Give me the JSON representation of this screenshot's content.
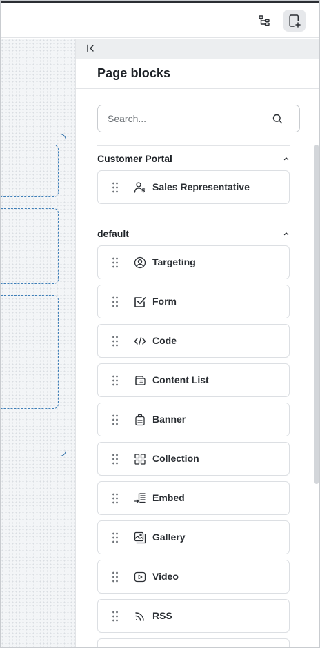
{
  "toolbar": {
    "tree_icon": "tree-structure-icon",
    "add_page_icon": "add-page-icon"
  },
  "panel": {
    "collapse_icon": "collapse-panel-icon",
    "title": "Page blocks",
    "search": {
      "placeholder": "Search...",
      "value": "",
      "icon": "search-icon"
    }
  },
  "sections": [
    {
      "title": "Customer Portal",
      "expanded": true,
      "blocks": [
        {
          "label": "Sales Representative",
          "icon": "user-dollar-icon"
        }
      ]
    },
    {
      "title": "default",
      "expanded": true,
      "blocks": [
        {
          "label": "Targeting",
          "icon": "user-circle-icon"
        },
        {
          "label": "Form",
          "icon": "checkbox-icon"
        },
        {
          "label": "Code",
          "icon": "code-icon"
        },
        {
          "label": "Content List",
          "icon": "content-list-icon"
        },
        {
          "label": "Banner",
          "icon": "banner-icon"
        },
        {
          "label": "Collection",
          "icon": "collection-grid-icon"
        },
        {
          "label": "Embed",
          "icon": "embed-icon"
        },
        {
          "label": "Gallery",
          "icon": "gallery-icon"
        },
        {
          "label": "Video",
          "icon": "video-icon"
        },
        {
          "label": "RSS",
          "icon": "rss-icon"
        }
      ]
    }
  ],
  "colors": {
    "canvas_frame": "#2f6fa8",
    "canvas_slot": "#3f7fb8",
    "active_tool_bg": "#e6e8eb"
  }
}
